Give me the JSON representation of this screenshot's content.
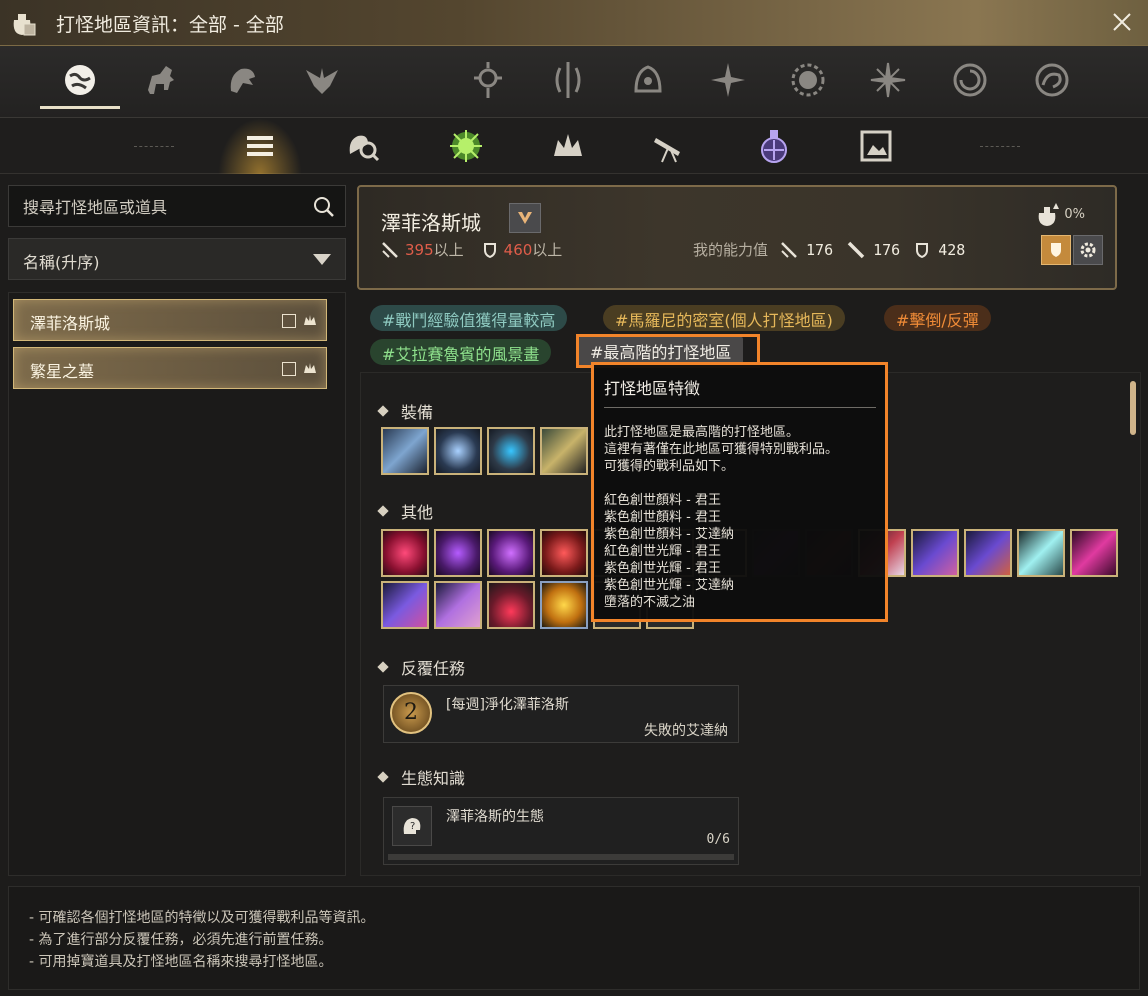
{
  "window": {
    "title": "打怪地區資訊：全部 - 全部"
  },
  "category_tabs": [
    {
      "icon": "world-icon",
      "active": true
    },
    {
      "icon": "horse-icon"
    },
    {
      "icon": "beast-icon"
    },
    {
      "icon": "eagle-crest-icon"
    },
    {
      "icon": "crescent-moon-icon"
    },
    {
      "icon": "orb-sun-icon"
    },
    {
      "icon": "vine-icon"
    },
    {
      "icon": "bell-icon"
    },
    {
      "icon": "star-burst-icon"
    },
    {
      "icon": "sun-gear-icon"
    },
    {
      "icon": "radiant-star-icon"
    },
    {
      "icon": "spiral-moon-icon"
    },
    {
      "icon": "swirl-icon"
    }
  ],
  "sub_tabs": [
    {
      "icon": "list-icon",
      "active": true
    },
    {
      "icon": "magnifier-head-icon"
    },
    {
      "icon": "green-burst-icon"
    },
    {
      "icon": "crown-icon"
    },
    {
      "icon": "telescope-icon"
    },
    {
      "icon": "lantern-icon"
    },
    {
      "icon": "picture-frame-icon"
    }
  ],
  "search": {
    "placeholder": "搜尋打怪地區或道具"
  },
  "sort": {
    "label": "名稱(升序)"
  },
  "zone_list": [
    {
      "label": "澤菲洛斯城"
    },
    {
      "label": "繁星之墓"
    }
  ],
  "zone": {
    "name": "澤菲洛斯城",
    "req_ap": "395",
    "req_ap_suffix": "以上",
    "req_dp": "460",
    "req_dp_suffix": "以上",
    "my_stats_label": "我的能力值",
    "my_ap": "176",
    "my_awk_ap": "176",
    "my_dp": "428",
    "drop_rate": "0%"
  },
  "tags": [
    {
      "label": "#戰鬥經驗值獲得量較高",
      "color": "#8ec9c0"
    },
    {
      "label": "#馬羅尼的密室(個人打怪地區)",
      "color": "#e6b85a"
    },
    {
      "label": "#擊倒/反彈",
      "color": "#ef8b37"
    },
    {
      "label": "#艾拉賽魯賓的風景畫",
      "color": "#8ee08c"
    },
    {
      "label": "#最高階的打怪地區",
      "color": "#f1ede5"
    }
  ],
  "sections": {
    "equipment": "裝備",
    "other": "其他",
    "repeat_quest": "反覆任務",
    "ecology": "生態知識"
  },
  "quest": {
    "badge": "2",
    "title": "[每週]淨化澤菲洛斯",
    "subtitle": "失敗的艾達納"
  },
  "ecology": {
    "title": "澤菲洛斯的生態",
    "progress": "0/6"
  },
  "tooltip": {
    "title": "打怪地區特徵",
    "lines": [
      "此打怪地區是最高階的打怪地區。",
      "這裡有著僅在此地區可獲得特別戰利品。",
      "可獲得的戰利品如下。",
      "",
      "紅色創世顏料 - 君王",
      "紫色創世顏料 - 君王",
      "紫色創世顏料 - 艾達納",
      "紅色創世光輝 - 君王",
      "紫色創世光輝 - 君王",
      "紫色創世光輝 - 艾達納",
      "墮落的不滅之油"
    ]
  },
  "help": [
    "- 可確認各個打怪地區的特徵以及可獲得戰利品等資訊。",
    "- 為了進行部分反覆任務，必須先進行前置任務。",
    "- 可用掉寶道具及打怪地區名稱來搜尋打怪地區。"
  ],
  "colors": {
    "accent_orange": "#f2842a",
    "req_red": "#e05d4a",
    "gold_border": "#c9b27a"
  }
}
